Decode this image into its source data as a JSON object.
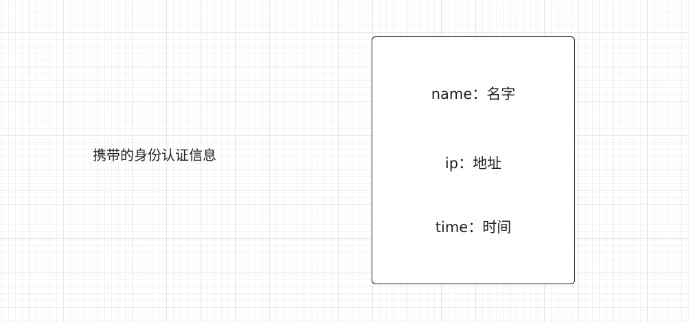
{
  "diagram": {
    "side_label": "携带的身份认证信息",
    "fields": [
      {
        "text": "name：名字"
      },
      {
        "text": "ip：地址"
      },
      {
        "text": "time：时间"
      }
    ]
  }
}
